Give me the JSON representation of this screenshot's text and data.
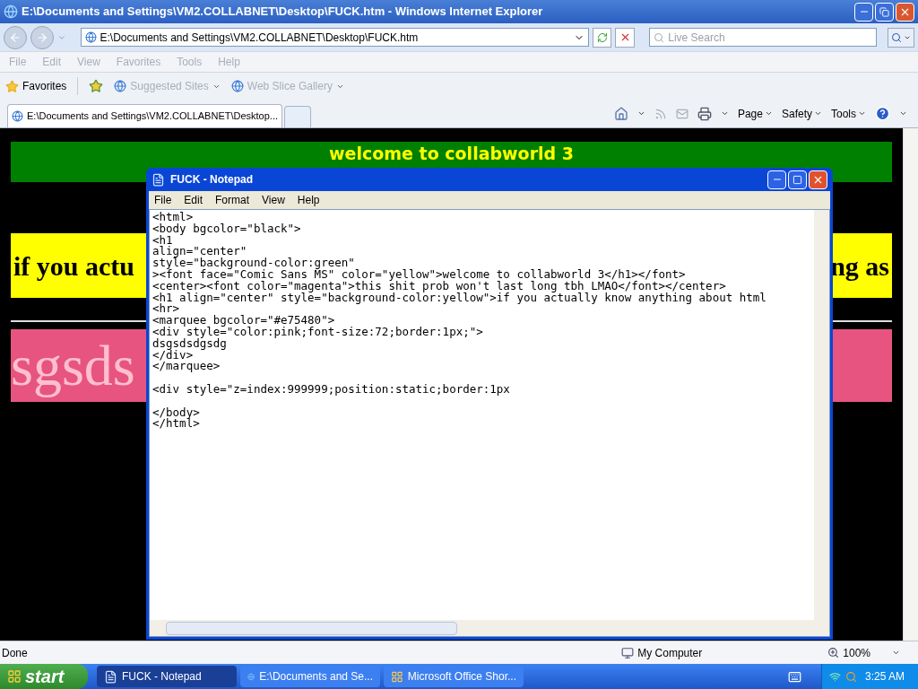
{
  "ie": {
    "title": "E:\\Documents and Settings\\VM2.COLLABNET\\Desktop\\FUCK.htm - Windows Internet Explorer",
    "address": "E:\\Documents and Settings\\VM2.COLLABNET\\Desktop\\FUCK.htm",
    "search": {
      "placeholder": "Live Search"
    },
    "menu": [
      "File",
      "Edit",
      "View",
      "Favorites",
      "Tools",
      "Help"
    ],
    "favorites": "Favorites",
    "links": [
      "Suggested Sites",
      "Web Slice Gallery"
    ],
    "tabs": [
      {
        "label": "E:\\Documents and Settings\\VM2.COLLABNET\\Desktop...",
        "selected": true
      }
    ],
    "commands": [
      "Page",
      "Safety",
      "Tools"
    ],
    "page": {
      "heading": "welcome to collabworld 3",
      "banner_left": "if you actu",
      "banner_right": "ng as",
      "marquee": "sgsds"
    },
    "status_bar": {
      "text": "Done",
      "zone": "My Computer",
      "zoom": "100%"
    }
  },
  "notepad": {
    "title": "FUCK - Notepad",
    "menu": [
      "File",
      "Edit",
      "Format",
      "View",
      "Help"
    ],
    "blocks": [
      [
        "<html>",
        "<body bgcolor=\"black\">",
        "<h1",
        "align=\"center\"",
        "style=\"background-color:green\"",
        "><font face=\"Comic Sans MS\" color=\"yellow\">welcome to collabworld 3</h1></font>",
        "<center><font color=\"magenta\">this shit prob won't last long tbh LMAO</font></center>",
        "<h1 align=\"center\" style=\"background-color:yellow\">if you actually know anything about html",
        "<hr>",
        "<marquee bgcolor=\"#e75480\">",
        "<div style=\"color:pink;font-size:72;border:1px;\">",
        "dsgsdsdgsdg",
        "</div>",
        "</marquee>"
      ],
      [
        "<div style=\"z=index:999999;position:static;border:1px"
      ],
      [
        "</body>",
        "</html>"
      ]
    ]
  },
  "taskbar": {
    "start": "start",
    "tasks": [
      {
        "kind": "notepad",
        "label": "FUCK - Notepad",
        "selected": true
      },
      {
        "kind": "browser",
        "label": "E:\\Documents and Se...",
        "selected": false
      },
      {
        "kind": "office",
        "label": "Microsoft Office Shor...",
        "selected": false
      }
    ],
    "clock": "3:25 AM"
  }
}
